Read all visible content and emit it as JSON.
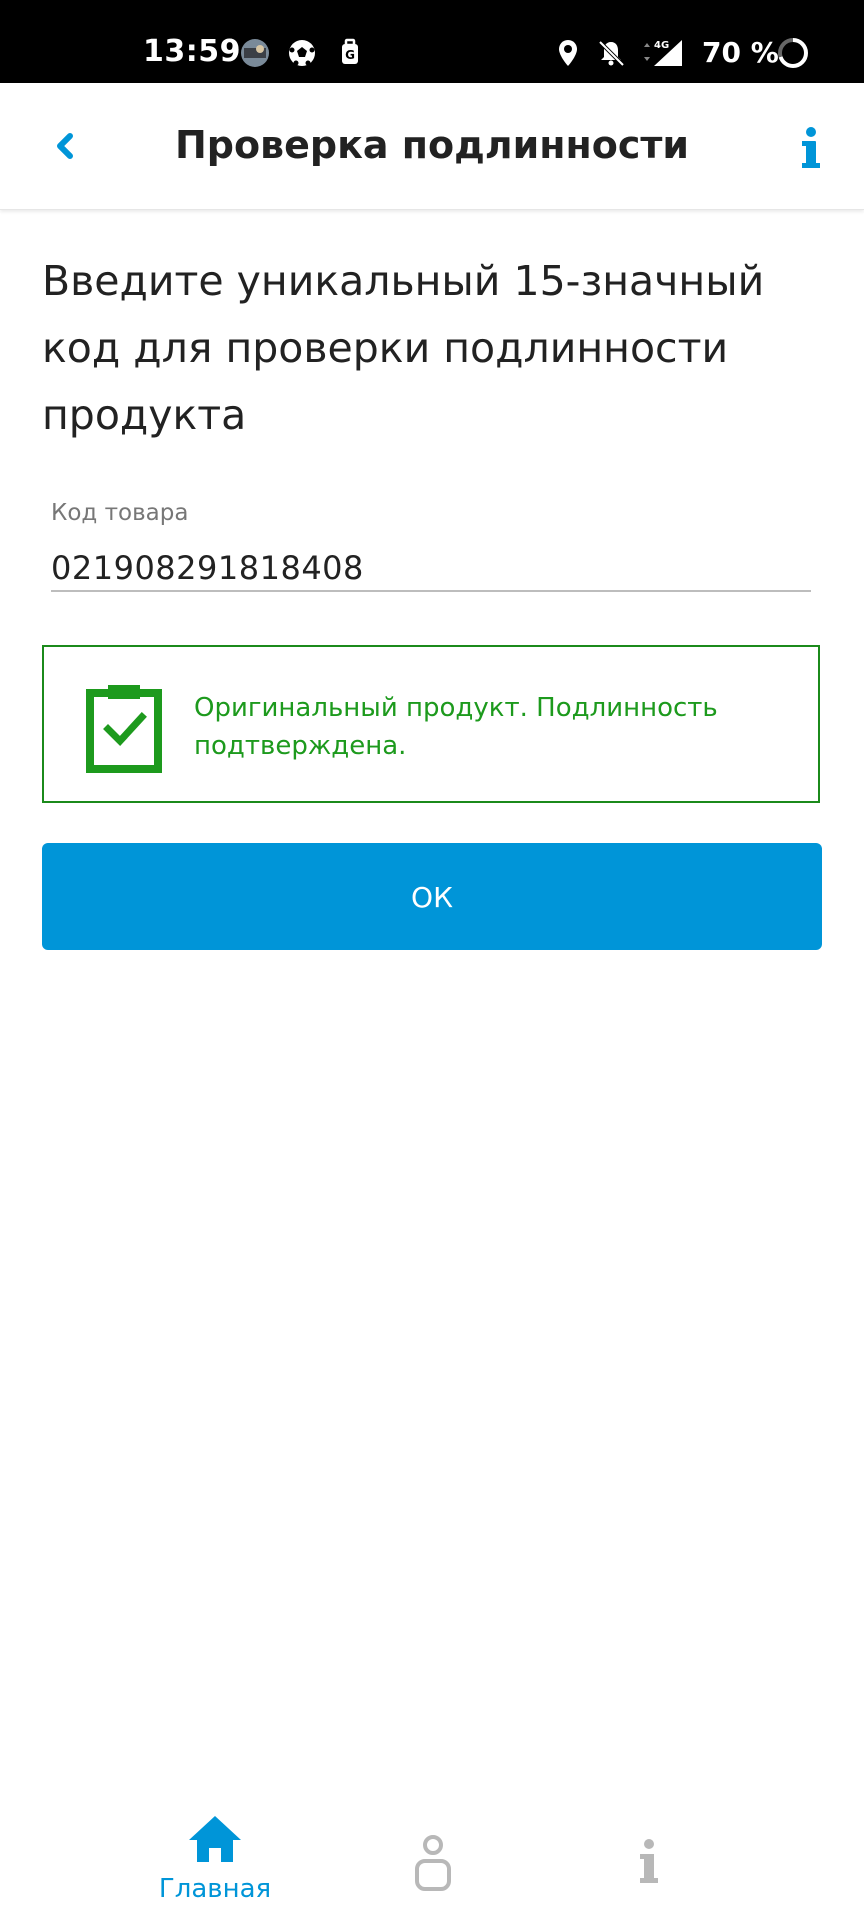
{
  "status_bar": {
    "time": "13:59",
    "battery_percent": "70 %",
    "icons": [
      "photo-avatar-icon",
      "soccer-ball-icon",
      "google-luggage-icon",
      "location-icon",
      "mute-bell-icon",
      "signal-4g-icon",
      "battery-ring-icon"
    ]
  },
  "app_bar": {
    "title": "Проверка подлинности",
    "back_icon": "chevron-left-icon",
    "info_icon": "info-icon"
  },
  "main": {
    "instruction": "Введите уникальный 15-значный код для проверки подлинности продукта",
    "code_field": {
      "label": "Код товара",
      "value": "021908291818408"
    },
    "result": {
      "icon": "clipboard-check-icon",
      "text": "Оригинальный продукт. Подлинность подтверждена.",
      "color": "#1d9a1d"
    },
    "ok_button": "ОК"
  },
  "bottom_nav": {
    "items": [
      {
        "label": "Главная",
        "icon": "home-icon",
        "active": true
      },
      {
        "label": "",
        "icon": "profile-icon",
        "active": false
      },
      {
        "label": "",
        "icon": "info-icon",
        "active": false
      }
    ]
  },
  "colors": {
    "accent": "#0095d8",
    "success": "#1d9a1d"
  }
}
